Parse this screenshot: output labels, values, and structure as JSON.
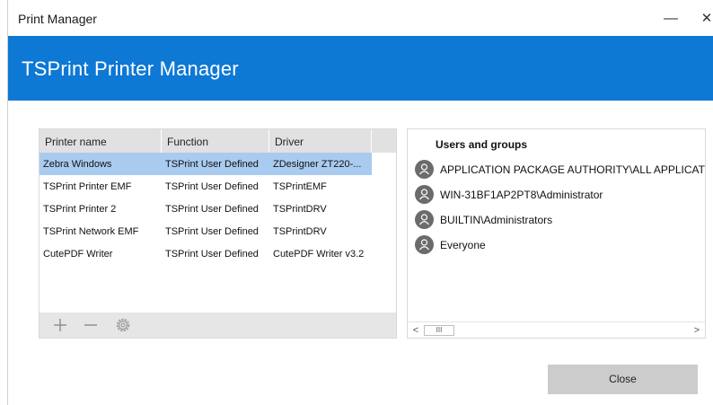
{
  "window": {
    "title": "Print Manager",
    "minimize_glyph": "—",
    "close_glyph": "✕"
  },
  "banner": {
    "title": "TSPrint Printer Manager",
    "color": "#0e78d5"
  },
  "printers": {
    "columns": [
      "Printer name",
      "Function",
      "Driver"
    ],
    "rows": [
      {
        "name": "Zebra Windows",
        "function": "TSPrint User Defined",
        "driver": "ZDesigner ZT220-...",
        "selected": true
      },
      {
        "name": "TSPrint Printer EMF",
        "function": "TSPrint User Defined",
        "driver": "TSPrintEMF"
      },
      {
        "name": "TSPrint Printer 2",
        "function": "TSPrint User Defined",
        "driver": "TSPrintDRV"
      },
      {
        "name": "TSPrint Network EMF",
        "function": "TSPrint User Defined",
        "driver": "TSPrintDRV"
      },
      {
        "name": "CutePDF Writer",
        "function": "TSPrint User Defined",
        "driver": "CutePDF Writer v3.2"
      }
    ],
    "toolbar": {
      "add_icon": "plus-icon",
      "remove_icon": "minus-icon",
      "settings_icon": "gear-icon"
    },
    "selection_color": "#a9cbef"
  },
  "users": {
    "title": "Users and groups",
    "items": [
      "APPLICATION PACKAGE AUTHORITY\\ALL APPLICATION PACKAGES",
      "WIN-31BF1AP2PT8\\Administrator",
      "BUILTIN\\Administrators",
      "Everyone"
    ],
    "avatar_icon": "user-icon",
    "scrollbar": {
      "left_glyph": "<",
      "thumb_glyph": "III",
      "right_glyph": ">"
    }
  },
  "footer": {
    "close_label": "Close"
  }
}
